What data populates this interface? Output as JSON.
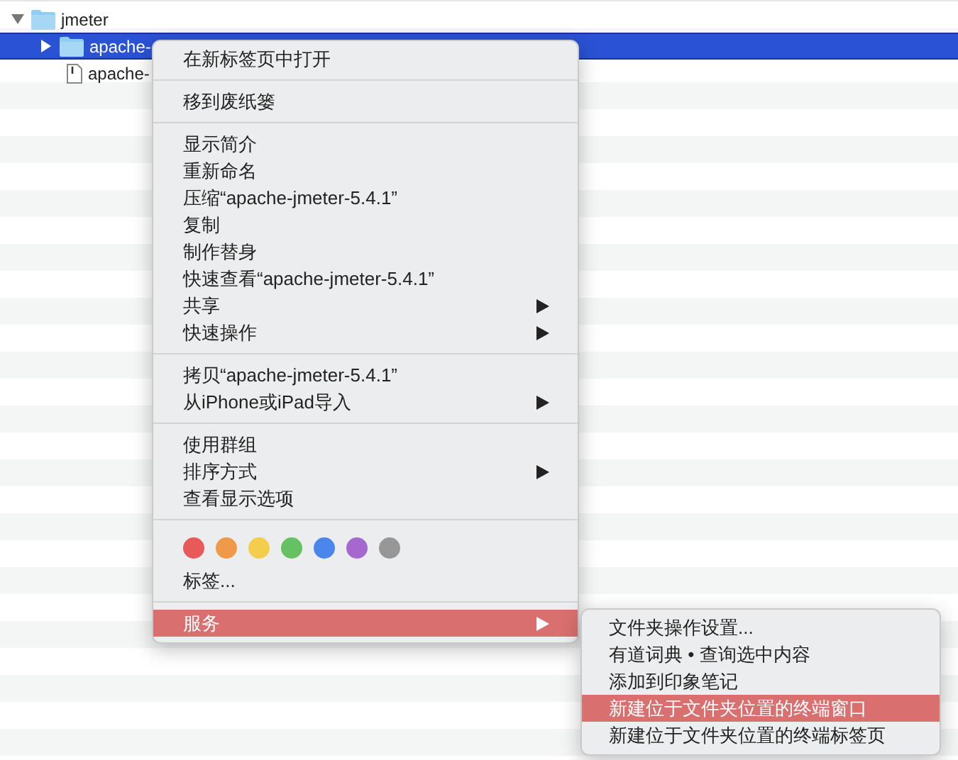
{
  "file_list": {
    "items": [
      {
        "name": "jmeter",
        "kind": "folder",
        "expanded": true,
        "selected": false,
        "children": [
          {
            "name": "apache-",
            "kind": "folder",
            "expanded": false,
            "selected": true
          },
          {
            "name": "apache-",
            "kind": "file",
            "selected": false
          }
        ]
      }
    ]
  },
  "context_menu": {
    "sections": [
      [
        {
          "kind": "item",
          "label": "在新标签页中打开",
          "submenu": false,
          "selected": false
        }
      ],
      [
        {
          "kind": "item",
          "label": "移到废纸篓",
          "submenu": false,
          "selected": false
        }
      ],
      [
        {
          "kind": "item",
          "label": "显示简介",
          "submenu": false,
          "selected": false
        },
        {
          "kind": "item",
          "label": "重新命名",
          "submenu": false,
          "selected": false
        },
        {
          "kind": "item",
          "label": "压缩“apache-jmeter-5.4.1”",
          "submenu": false,
          "selected": false
        },
        {
          "kind": "item",
          "label": "复制",
          "submenu": false,
          "selected": false
        },
        {
          "kind": "item",
          "label": "制作替身",
          "submenu": false,
          "selected": false
        },
        {
          "kind": "item",
          "label": "快速查看“apache-jmeter-5.4.1”",
          "submenu": false,
          "selected": false
        },
        {
          "kind": "item",
          "label": "共享",
          "submenu": true,
          "selected": false
        },
        {
          "kind": "item",
          "label": "快速操作",
          "submenu": true,
          "selected": false
        }
      ],
      [
        {
          "kind": "item",
          "label": "拷贝“apache-jmeter-5.4.1”",
          "submenu": false,
          "selected": false
        },
        {
          "kind": "item",
          "label": "从iPhone或iPad导入",
          "submenu": true,
          "selected": false
        }
      ],
      [
        {
          "kind": "item",
          "label": "使用群组",
          "submenu": false,
          "selected": false
        },
        {
          "kind": "item",
          "label": "排序方式",
          "submenu": true,
          "selected": false
        },
        {
          "kind": "item",
          "label": "查看显示选项",
          "submenu": false,
          "selected": false
        }
      ],
      [
        {
          "kind": "tags",
          "tags": [
            {
              "color": "#e8595a"
            },
            {
              "color": "#ef9a48"
            },
            {
              "color": "#f3cd4b"
            },
            {
              "color": "#65c161"
            },
            {
              "color": "#4a86ec"
            },
            {
              "color": "#a468cf"
            },
            {
              "color": "#979797"
            }
          ]
        },
        {
          "kind": "item",
          "label": "标签...",
          "submenu": false,
          "selected": false
        }
      ],
      [
        {
          "kind": "item",
          "label": "服务",
          "submenu": true,
          "selected": true
        }
      ]
    ]
  },
  "services_submenu": {
    "sections": [
      [
        {
          "kind": "item",
          "label": "文件夹操作设置...",
          "submenu": false,
          "selected": false
        },
        {
          "kind": "item",
          "label": "有道词典 • 查询选中内容",
          "submenu": false,
          "selected": false
        },
        {
          "kind": "item",
          "label": "添加到印象笔记",
          "submenu": false,
          "selected": false
        },
        {
          "kind": "item",
          "label": "新建位于文件夹位置的终端窗口",
          "submenu": false,
          "selected": true
        },
        {
          "kind": "item",
          "label": "新建位于文件夹位置的终端标签页",
          "submenu": false,
          "selected": false
        }
      ]
    ]
  }
}
